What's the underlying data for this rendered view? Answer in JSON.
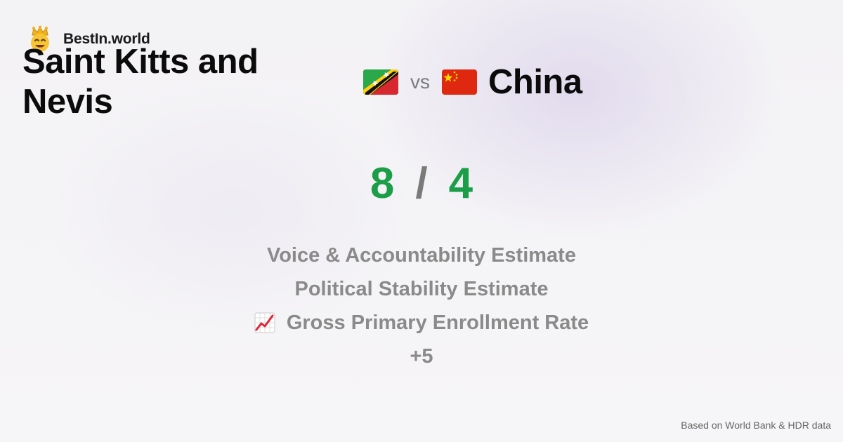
{
  "brand": {
    "name": "BestIn.world",
    "icon": "crown-smiley-icon"
  },
  "comparison": {
    "country1": {
      "name": "Saint Kitts and Nevis",
      "flag": "saint-kitts-and-nevis-flag-icon"
    },
    "vs_label": "vs",
    "country2": {
      "name": "China",
      "flag": "china-flag-icon"
    }
  },
  "score": {
    "country1_wins": "8",
    "separator": "/",
    "country2_wins": "4",
    "color": "#1c9e48"
  },
  "metrics": [
    {
      "label": "Voice & Accountability Estimate",
      "icon": ""
    },
    {
      "label": "Political Stability Estimate",
      "icon": ""
    },
    {
      "label": "Gross Primary Enrollment Rate",
      "icon": "chart-increasing-icon"
    }
  ],
  "more_label": "+5",
  "footer": {
    "text": "Based on World Bank & HDR data"
  }
}
